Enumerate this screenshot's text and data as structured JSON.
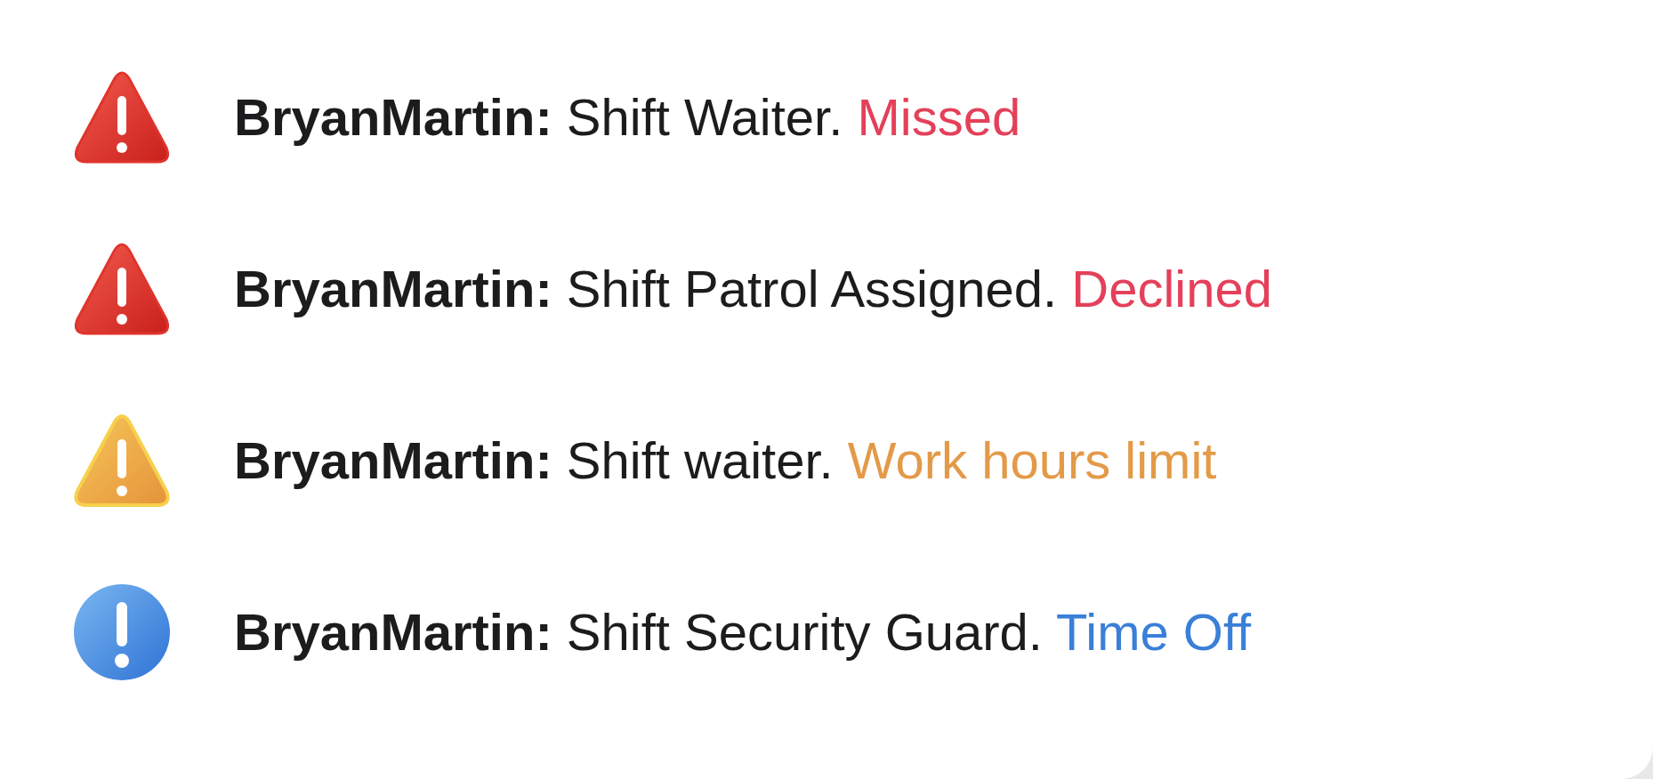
{
  "notifications": [
    {
      "kind": "error",
      "user": "BryanMartin:",
      "message": "Shift Waiter.",
      "status": "Missed",
      "color": "#e4405a"
    },
    {
      "kind": "error",
      "user": "BryanMartin:",
      "message": "Shift Patrol Assigned.",
      "status": "Declined",
      "color": "#e4405a"
    },
    {
      "kind": "warning",
      "user": "BryanMartin:",
      "message": "Shift waiter.",
      "status": "Work hours limit",
      "color": "#e39a48"
    },
    {
      "kind": "info",
      "user": "BryanMartin:",
      "message": "Shift Security Guard.",
      "status": "Time Off",
      "color": "#3a7fd8"
    }
  ]
}
